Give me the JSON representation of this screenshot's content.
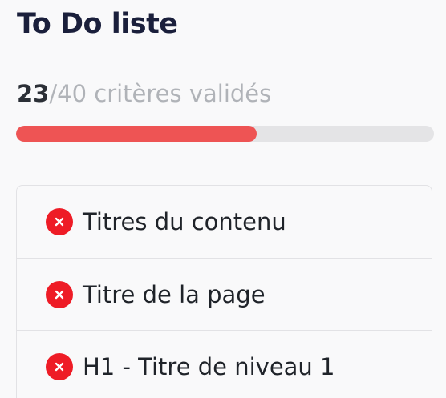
{
  "title": "To Do liste",
  "progress": {
    "done": "23",
    "total_text": "/40 critères validés",
    "fraction": 0.575,
    "bar_color": "#ee5454",
    "track_color": "#e4e4e6"
  },
  "items": [
    {
      "label": "Titres du contenu",
      "status": "invalid",
      "icon": "x-circle-icon"
    },
    {
      "label": "Titre de la page",
      "status": "invalid",
      "icon": "x-circle-icon"
    },
    {
      "label": "H1 - Titre de niveau 1",
      "status": "invalid",
      "icon": "x-circle-icon"
    }
  ],
  "colors": {
    "invalid": "#ee1c26",
    "title": "#1a1f3b"
  }
}
